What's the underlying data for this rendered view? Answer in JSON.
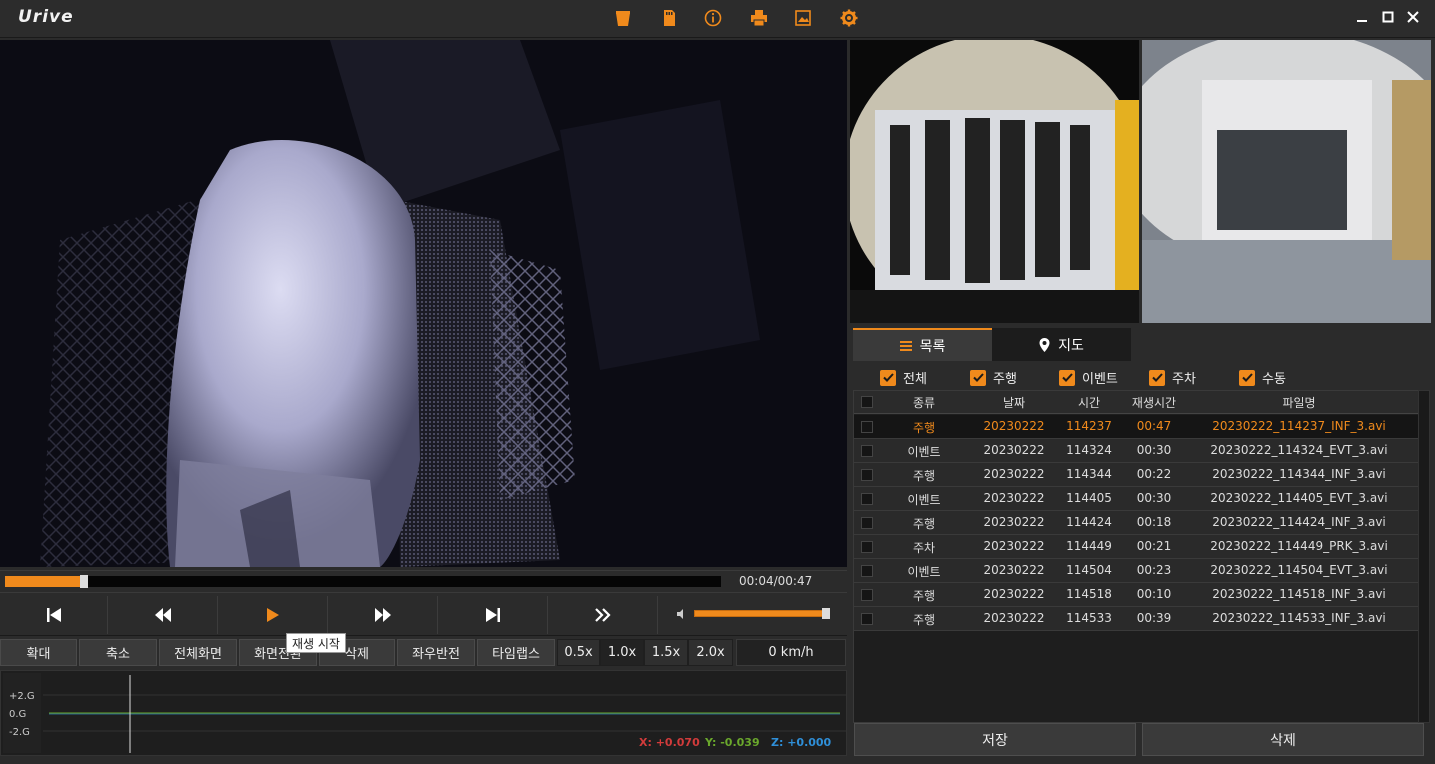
{
  "app": {
    "title": "Urive"
  },
  "toolbar": {
    "icons": [
      "folder-icon",
      "sd-card-icon",
      "info-icon",
      "print-icon",
      "image-export-icon",
      "settings-gear-icon"
    ]
  },
  "window": {
    "minimize": "—",
    "maximize": "□",
    "close": "✕"
  },
  "playback": {
    "time": "00:04/00:47",
    "progress": 0.108,
    "volume": 1.0
  },
  "tooltip": "재생 시작",
  "buttons": {
    "zoom_in": "확대",
    "zoom_out": "축소",
    "fullscreen": "전체화면",
    "screen_switch": "화면전환",
    "delete": "삭제",
    "mirror": "좌우반전",
    "timelapse": "타임랩스"
  },
  "speeds": [
    "0.5x",
    "1.0x",
    "1.5x",
    "2.0x"
  ],
  "speed_selected": "1.0x",
  "speed_display": "0 km/h",
  "gsensor": {
    "labels": [
      "+2.G",
      "0.G",
      "-2.G"
    ],
    "x": "X: +0.070",
    "y": "Y: -0.039",
    "z": "Z: +0.000",
    "colors": {
      "x": "#d23b3b",
      "y": "#6aa82c",
      "z": "#2f8fd8"
    }
  },
  "tabs": {
    "list": "목록",
    "map": "지도"
  },
  "filters": [
    "전체",
    "주행",
    "이벤트",
    "주차",
    "수동"
  ],
  "table": {
    "headers": [
      "종류",
      "날짜",
      "시간",
      "재생시간",
      "파일명"
    ],
    "rows": [
      [
        "주행",
        "20230222",
        "114237",
        "00:47",
        "20230222_114237_INF_3.avi"
      ],
      [
        "이벤트",
        "20230222",
        "114324",
        "00:30",
        "20230222_114324_EVT_3.avi"
      ],
      [
        "주행",
        "20230222",
        "114344",
        "00:22",
        "20230222_114344_INF_3.avi"
      ],
      [
        "이벤트",
        "20230222",
        "114405",
        "00:30",
        "20230222_114405_EVT_3.avi"
      ],
      [
        "주행",
        "20230222",
        "114424",
        "00:18",
        "20230222_114424_INF_3.avi"
      ],
      [
        "주차",
        "20230222",
        "114449",
        "00:21",
        "20230222_114449_PRK_3.avi"
      ],
      [
        "이벤트",
        "20230222",
        "114504",
        "00:23",
        "20230222_114504_EVT_3.avi"
      ],
      [
        "주행",
        "20230222",
        "114518",
        "00:10",
        "20230222_114518_INF_3.avi"
      ],
      [
        "주행",
        "20230222",
        "114533",
        "00:39",
        "20230222_114533_INF_3.avi"
      ]
    ],
    "selected": 0
  },
  "bottom": {
    "save": "저장",
    "delete": "삭제"
  },
  "colors": {
    "accent": "#f08a1c",
    "background": "#2b2b2b"
  }
}
